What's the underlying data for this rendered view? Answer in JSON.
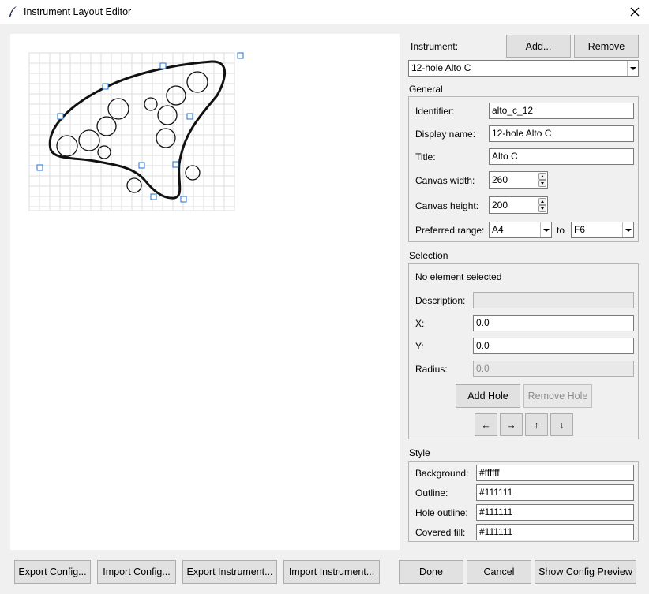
{
  "window": {
    "title": "Instrument Layout Editor",
    "app_icon": "feather-icon",
    "close_icon": "close-icon"
  },
  "instrument": {
    "label": "Instrument:",
    "add_label": "Add...",
    "remove_label": "Remove",
    "selected": "12-hole Alto C"
  },
  "general": {
    "title": "General",
    "identifier_label": "Identifier:",
    "identifier_value": "alto_c_12",
    "display_name_label": "Display name:",
    "display_name_value": "12-hole Alto C",
    "title_label": "Title:",
    "title_value": "Alto C",
    "canvas_width_label": "Canvas width:",
    "canvas_width_value": "260",
    "canvas_height_label": "Canvas height:",
    "canvas_height_value": "200",
    "preferred_range_label": "Preferred range:",
    "range_from": "A4",
    "range_to_label": "to",
    "range_to": "F6"
  },
  "selection": {
    "title": "Selection",
    "status": "No element selected",
    "description_label": "Description:",
    "description_value": "",
    "x_label": "X:",
    "x_value": "0.0",
    "y_label": "Y:",
    "y_value": "0.0",
    "radius_label": "Radius:",
    "radius_value": "0.0",
    "add_hole_label": "Add Hole",
    "remove_hole_label": "Remove Hole",
    "move_left": "←",
    "move_right": "→",
    "move_up": "↑",
    "move_down": "↓"
  },
  "style": {
    "title": "Style",
    "background_label": "Background:",
    "background_value": "#ffffff",
    "outline_label": "Outline:",
    "outline_value": "#111111",
    "hole_outline_label": "Hole outline:",
    "hole_outline_value": "#111111",
    "covered_fill_label": "Covered fill:",
    "covered_fill_value": "#111111"
  },
  "footer": {
    "export_config": "Export Config...",
    "import_config": "Import Config...",
    "export_instrument": "Export Instrument...",
    "import_instrument": "Import Instrument...",
    "done": "Done",
    "cancel": "Cancel",
    "show_preview": "Show Config Preview"
  },
  "colors": {
    "window_bg": "#f0f0f0",
    "handle": "#1f6fd1",
    "outline": "#111111",
    "grid": "#dddddd"
  }
}
